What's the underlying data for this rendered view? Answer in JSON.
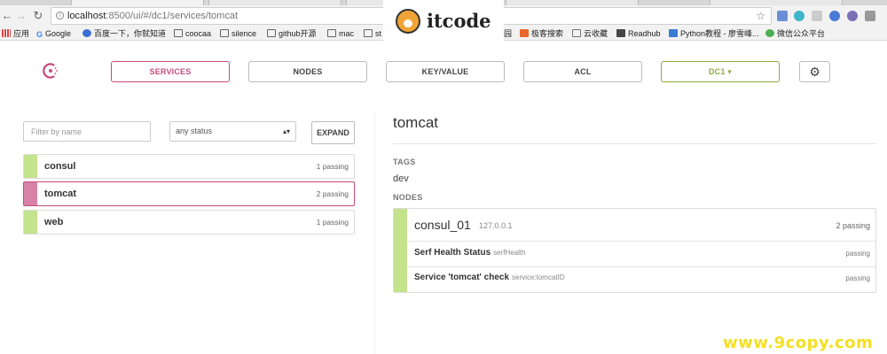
{
  "browser": {
    "url_host": "localhost",
    "url_path": ":8500/ui/#/dc1/services/tomcat",
    "bookmarks": [
      "应用",
      "Google",
      "百度一下，你就知道",
      "coocaa",
      "silence",
      "github开源",
      "mac",
      "st",
      "园",
      "极客搜索",
      "云收藏",
      "Readhub",
      "Python教程 - 廖雪峰...",
      "微信公众平台"
    ]
  },
  "watermark": {
    "top_text": "itcode",
    "bottom_text": "www.9copy.com"
  },
  "nav": {
    "services": "SERVICES",
    "nodes": "NODES",
    "keyvalue": "KEY/VALUE",
    "acl": "ACL",
    "dc": "DC1 ▾"
  },
  "filter": {
    "placeholder": "Filter by name",
    "status": "any status",
    "expand": "EXPAND"
  },
  "services": [
    {
      "name": "consul",
      "status": "1 passing"
    },
    {
      "name": "tomcat",
      "status": "2 passing"
    },
    {
      "name": "web",
      "status": "1 passing"
    }
  ],
  "detail": {
    "title": "tomcat",
    "tags_label": "TAGS",
    "tag": "dev",
    "nodes_label": "NODES",
    "node": {
      "name": "consul_01",
      "address": "127.0.0.1",
      "status": "2 passing",
      "checks": [
        {
          "name": "Serf Health Status",
          "id": "serfHealth",
          "status": "passing"
        },
        {
          "name": "Service 'tomcat' check",
          "id": "service:tomcatID",
          "status": "passing"
        }
      ]
    }
  },
  "colors": {
    "accent": "#c74b7c",
    "passing": "#c4e38d",
    "dc": "#8cad3e"
  }
}
